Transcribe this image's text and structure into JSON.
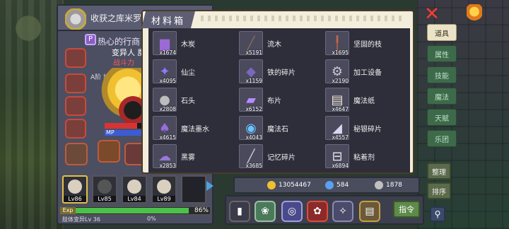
{
  "character": {
    "name": "收获之库米罗",
    "trait": "热心的行商",
    "mutant_label": "变异人 魔",
    "power_label": "战斗力",
    "description": "A阶 地狱使",
    "mp_label": "MP"
  },
  "party": [
    {
      "level": "Lv86"
    },
    {
      "level": "Lv85"
    },
    {
      "level": "Lv84"
    },
    {
      "level": "Lv89"
    }
  ],
  "exp": {
    "label": "Exp",
    "percent": "86%",
    "sub_left": "肢体变异Lv 36",
    "sub_percent": "0%"
  },
  "material_box": {
    "title": "材料箱",
    "items": [
      {
        "name": "木炭",
        "qty": "x1674",
        "icon": "charcoal-icon",
        "glyph": "▆",
        "color": "#9c6ad6"
      },
      {
        "name": "流木",
        "qty": "x5191",
        "icon": "driftwood-icon",
        "glyph": "╱",
        "color": "#8a6a5a"
      },
      {
        "name": "坚固的枝",
        "qty": "x1695",
        "icon": "branch-icon",
        "glyph": "╿",
        "color": "#c0654a"
      },
      {
        "name": "仙尘",
        "qty": "x4095",
        "icon": "fairy-dust-icon",
        "glyph": "✦",
        "color": "#8a7aff"
      },
      {
        "name": "铁的碎片",
        "qty": "x1159",
        "icon": "iron-shard-icon",
        "glyph": "◆",
        "color": "#7a68c0"
      },
      {
        "name": "加工设备",
        "qty": "x2190",
        "icon": "processing-gear-icon",
        "glyph": "⚙",
        "color": "#c8c8d8"
      },
      {
        "name": "石头",
        "qty": "x2808",
        "icon": "stone-icon",
        "glyph": "●",
        "color": "#bdbdbd"
      },
      {
        "name": "布片",
        "qty": "x6152",
        "icon": "cloth-icon",
        "glyph": "▰",
        "color": "#b88aff"
      },
      {
        "name": "魔法纸",
        "qty": "x4647",
        "icon": "magic-paper-icon",
        "glyph": "▤",
        "color": "#efe6d4"
      },
      {
        "name": "魔法墨水",
        "qty": "x4615",
        "icon": "magic-ink-icon",
        "glyph": "♠",
        "color": "#9a6ae0"
      },
      {
        "name": "魔法石",
        "qty": "x4043",
        "icon": "magic-stone-icon",
        "glyph": "◉",
        "color": "#6ac4ff"
      },
      {
        "name": "秘银碎片",
        "qty": "x4557",
        "icon": "mithril-shard-icon",
        "glyph": "◢",
        "color": "#d8d8f0"
      },
      {
        "name": "黑雾",
        "qty": "x2853",
        "icon": "black-fog-icon",
        "glyph": "☁",
        "color": "#9a78d8"
      },
      {
        "name": "记忆碎片",
        "qty": "x3685",
        "icon": "memory-shard-icon",
        "glyph": "╱",
        "color": "#c8c8d8"
      },
      {
        "name": "粘着剂",
        "qty": "x6894",
        "icon": "adhesive-icon",
        "glyph": "⊟",
        "color": "#e8e8f0"
      }
    ]
  },
  "right_tabs": [
    {
      "label": "道具",
      "active": true
    },
    {
      "label": "属性",
      "active": false
    },
    {
      "label": "技能",
      "active": false
    },
    {
      "label": "魔法",
      "active": false
    },
    {
      "label": "天赋",
      "active": false
    },
    {
      "label": "乐团",
      "active": false
    }
  ],
  "actions": {
    "sort_label": "整理",
    "order_label": "排序",
    "command_label": "指令"
  },
  "resources": {
    "gold": "13054467",
    "gems": "584",
    "silver": "1878"
  }
}
